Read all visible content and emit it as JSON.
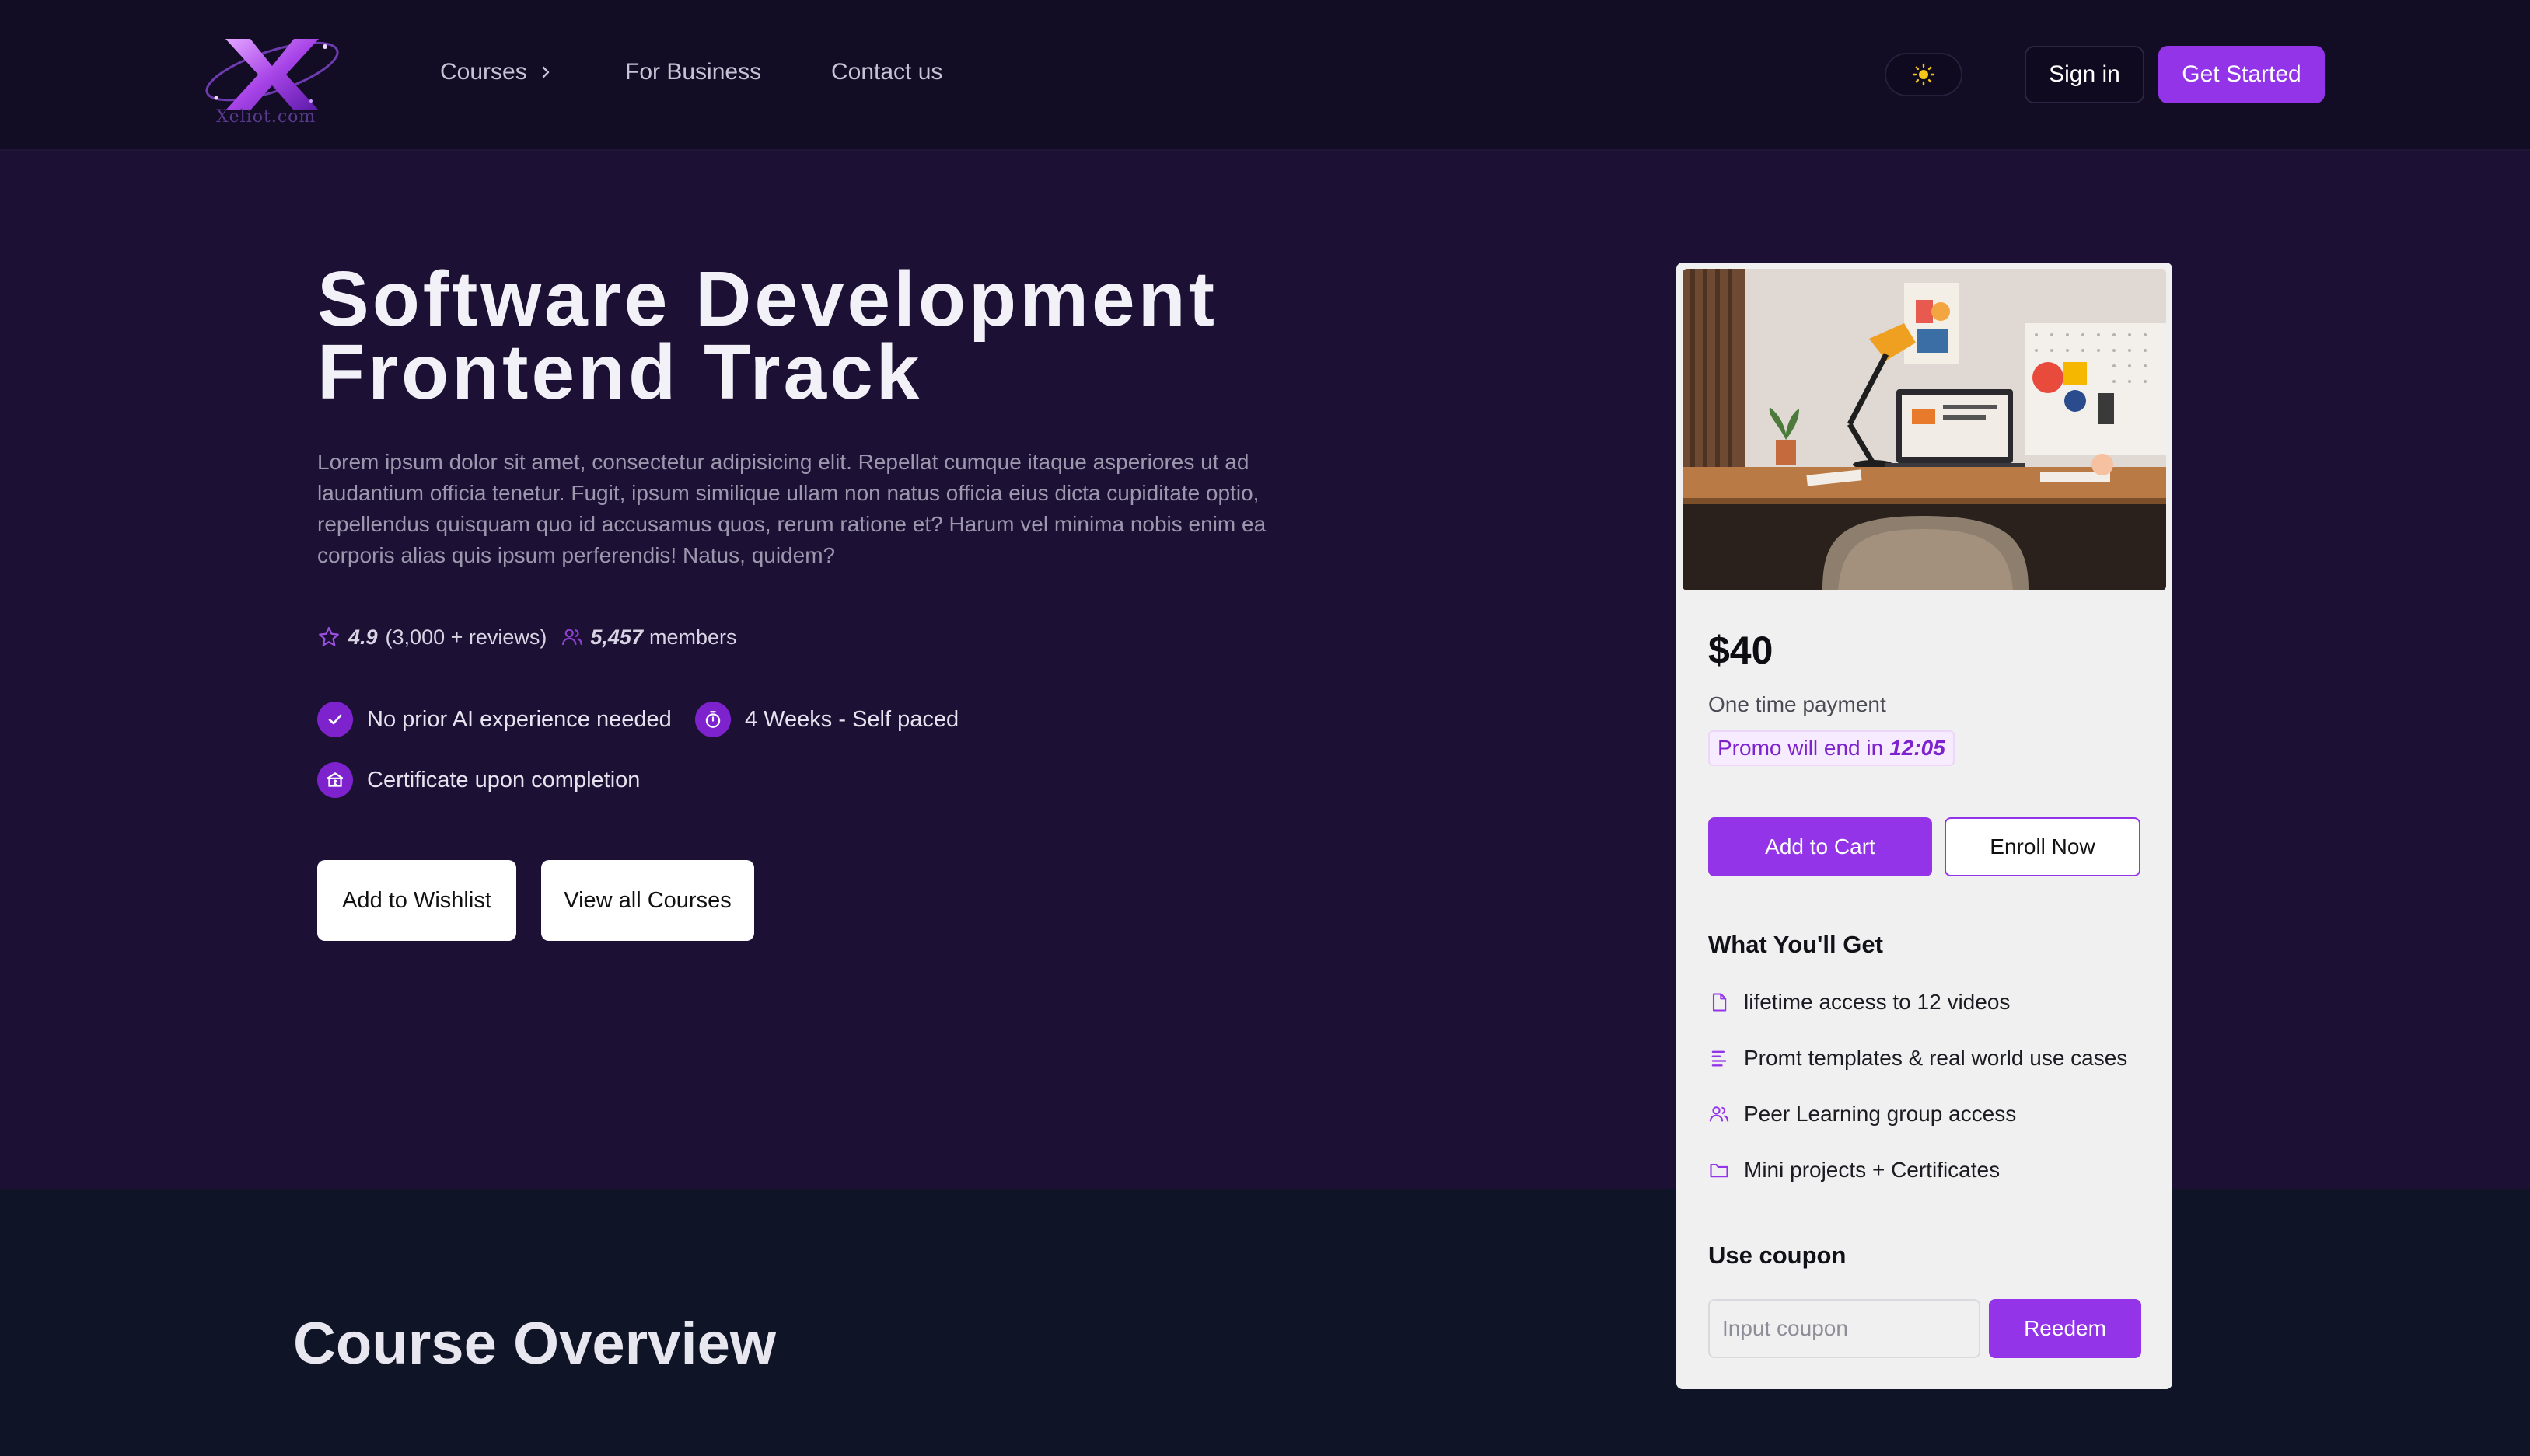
{
  "header": {
    "logo_text": "Xeliot.com",
    "nav": [
      {
        "label": "Courses"
      },
      {
        "label": "For Business"
      },
      {
        "label": "Contact us"
      }
    ],
    "sign_in_label": "Sign in",
    "get_started_label": "Get Started",
    "theme_toggle_icon": "sun-icon"
  },
  "hero": {
    "title_line1": "Software Development",
    "title_line2": "Frontend Track",
    "description": "Lorem ipsum dolor sit amet, consectetur adipisicing elit. Repellat cumque itaque asperiores ut ad laudantium officia tenetur. Fugit, ipsum similique ullam non natus officia eius dicta cupiditate optio, repellendus quisquam quo id accusamus quos, rerum ratione et? Harum vel minima nobis enim ea corporis alias quis ipsum perferendis! Natus, quidem?",
    "rating": "4.9",
    "reviews": "(3,000 + reviews)",
    "members_count": "5,457",
    "members_label": "members",
    "features": [
      {
        "label": "No prior AI experience needed",
        "icon": "check-icon"
      },
      {
        "label": "4 Weeks - Self paced",
        "icon": "stopwatch-icon"
      },
      {
        "label": "Certificate upon completion",
        "icon": "certificate-icon"
      }
    ],
    "wishlist_label": "Add to Wishlist",
    "view_all_label": "View all Courses"
  },
  "card": {
    "price": "$40",
    "payment_note": "One time payment",
    "promo_text": "Promo will end in",
    "promo_time": "12:05",
    "add_to_cart_label": "Add to Cart",
    "enroll_label": "Enroll Now",
    "what_you_get_title": "What You'll Get",
    "benefits": [
      {
        "label": "lifetime access to 12 videos",
        "icon": "file-icon"
      },
      {
        "label": "Promt templates & real world use cases",
        "icon": "align-left-icon"
      },
      {
        "label": "Peer Learning group access",
        "icon": "users-icon"
      },
      {
        "label": "Mini projects + Certificates",
        "icon": "folder-icon"
      }
    ],
    "coupon_title": "Use coupon",
    "coupon_placeholder": "Input coupon",
    "redeem_label": "Reedem"
  },
  "overview": {
    "title": "Course Overview"
  },
  "colors": {
    "accent": "#9334e9",
    "header_bg": "#120c24",
    "hero_bg": "#1c1034",
    "lower_bg": "#0f1526",
    "card_bg": "#f1f0f1"
  }
}
